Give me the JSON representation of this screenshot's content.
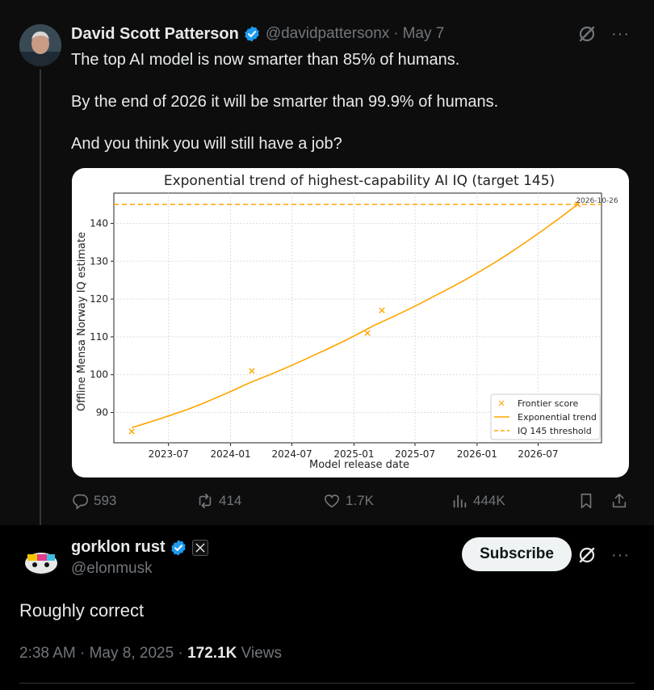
{
  "parent_tweet": {
    "author_name": "David Scott Patterson",
    "author_handle": "@davidpattersonx",
    "separator": "·",
    "date": "May 7",
    "text_lines": [
      "The top AI model is now smarter than 85% of humans.",
      "By the end of 2026 it will be smarter than 99.9% of humans.",
      "And you think you will still have a job?"
    ],
    "actions": {
      "replies": "593",
      "reposts": "414",
      "likes": "1.7K",
      "views": "444K"
    }
  },
  "reply_tweet": {
    "author_name": "gorklon rust",
    "author_handle": "@elonmusk",
    "subscribe_label": "Subscribe",
    "text": "Roughly correct",
    "time": "2:38 AM",
    "sep1": "·",
    "date": "May 8, 2025",
    "sep2": "·",
    "views_count": "172.1K",
    "views_label": "Views"
  },
  "icons": {
    "verified": "verified-badge-icon",
    "grok": "grok-icon",
    "more": "more-icon",
    "reply": "reply-icon",
    "repost": "repost-icon",
    "like": "heart-icon",
    "views": "views-icon",
    "bookmark": "bookmark-icon",
    "share": "share-icon",
    "x_badge": "x-logo-icon"
  },
  "colors": {
    "verified_blue": "#1d9bf0",
    "chart_orange": "#ffa500",
    "muted_text": "#71767b"
  },
  "chart_data": {
    "type": "line",
    "title": "Exponential trend of highest-capability AI IQ (target 145)",
    "xlabel": "Model release date",
    "ylabel": "Offline Mensa Norway IQ estimate",
    "x_ticks": [
      "2023-07",
      "2024-01",
      "2024-07",
      "2025-01",
      "2025-07",
      "2026-01",
      "2026-07"
    ],
    "y_ticks": [
      90,
      100,
      110,
      120,
      130,
      140
    ],
    "ylim": [
      82,
      148
    ],
    "xlim": [
      "2023-01-20",
      "2027-01-05"
    ],
    "grid": true,
    "legend_position": "bottom-right",
    "series": [
      {
        "name": "Frontier score",
        "kind": "scatter",
        "marker": "x",
        "color": "#ffa500",
        "points": [
          {
            "x": "2023-03-14",
            "y": 85
          },
          {
            "x": "2024-03-04",
            "y": 101
          },
          {
            "x": "2025-02-10",
            "y": 111
          },
          {
            "x": "2025-03-25",
            "y": 117
          },
          {
            "x": "2026-10-26",
            "y": 145
          }
        ]
      },
      {
        "name": "Exponential trend",
        "kind": "line",
        "color": "#ffa500",
        "points": [
          {
            "x": "2023-03-14",
            "y": 86
          },
          {
            "x": "2023-09-01",
            "y": 91
          },
          {
            "x": "2024-03-01",
            "y": 98
          },
          {
            "x": "2024-09-01",
            "y": 105
          },
          {
            "x": "2025-03-01",
            "y": 113
          },
          {
            "x": "2025-09-01",
            "y": 121
          },
          {
            "x": "2026-03-01",
            "y": 130
          },
          {
            "x": "2026-10-26",
            "y": 145
          }
        ]
      },
      {
        "name": "IQ 145 threshold",
        "kind": "hline",
        "dashed": true,
        "color": "#ffa500",
        "y": 145
      }
    ],
    "annotations": [
      {
        "text": "2026-10-26",
        "x": "2026-10-26",
        "y": 145
      }
    ]
  }
}
